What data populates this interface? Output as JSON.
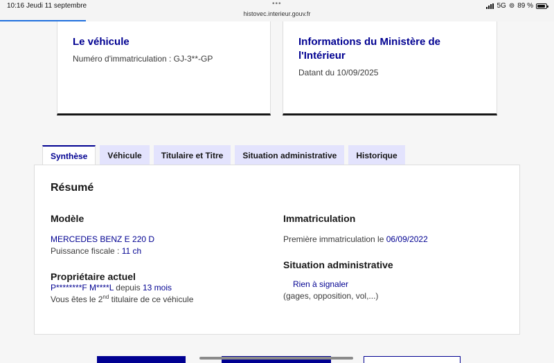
{
  "status_bar": {
    "time": "10:16",
    "date": "Jeudi 11 septembre",
    "url": "histovec.interieur.gouv.fr",
    "network": "5G",
    "battery": "89 %"
  },
  "vehicle_card": {
    "title": "Le véhicule",
    "registration": "Numéro d'immatriculation : GJ-3**-GP"
  },
  "ministry_card": {
    "title": "Informations du Ministère de l'Intérieur",
    "date": "Datant du 10/09/2025"
  },
  "tabs": [
    {
      "label": "Synthèse"
    },
    {
      "label": "Véhicule"
    },
    {
      "label": "Titulaire et Titre"
    },
    {
      "label": "Situation administrative"
    },
    {
      "label": "Historique"
    }
  ],
  "summary": {
    "title": "Résumé",
    "model": {
      "heading": "Modèle",
      "name": "MERCEDES BENZ E 220 D",
      "power_label": "Puissance fiscale : ",
      "power_value": "11 ch"
    },
    "owner": {
      "heading": "Propriétaire actuel",
      "name": "P********F M****L",
      "since_label": " depuis ",
      "since_value": "13 mois",
      "rank_prefix": "Vous êtes le 2",
      "rank_sup": "nd",
      "rank_suffix": " titulaire de ce véhicule"
    },
    "registration": {
      "heading": "Immatriculation",
      "first_label": "Première immatriculation le ",
      "first_date": "06/09/2022"
    },
    "admin": {
      "heading": "Situation administrative",
      "status": "Rien à signaler",
      "details": "(gages, opposition, vol,...)"
    }
  },
  "colors": {
    "accent": "#000091",
    "tab_inactive": "#e3e3fd"
  }
}
